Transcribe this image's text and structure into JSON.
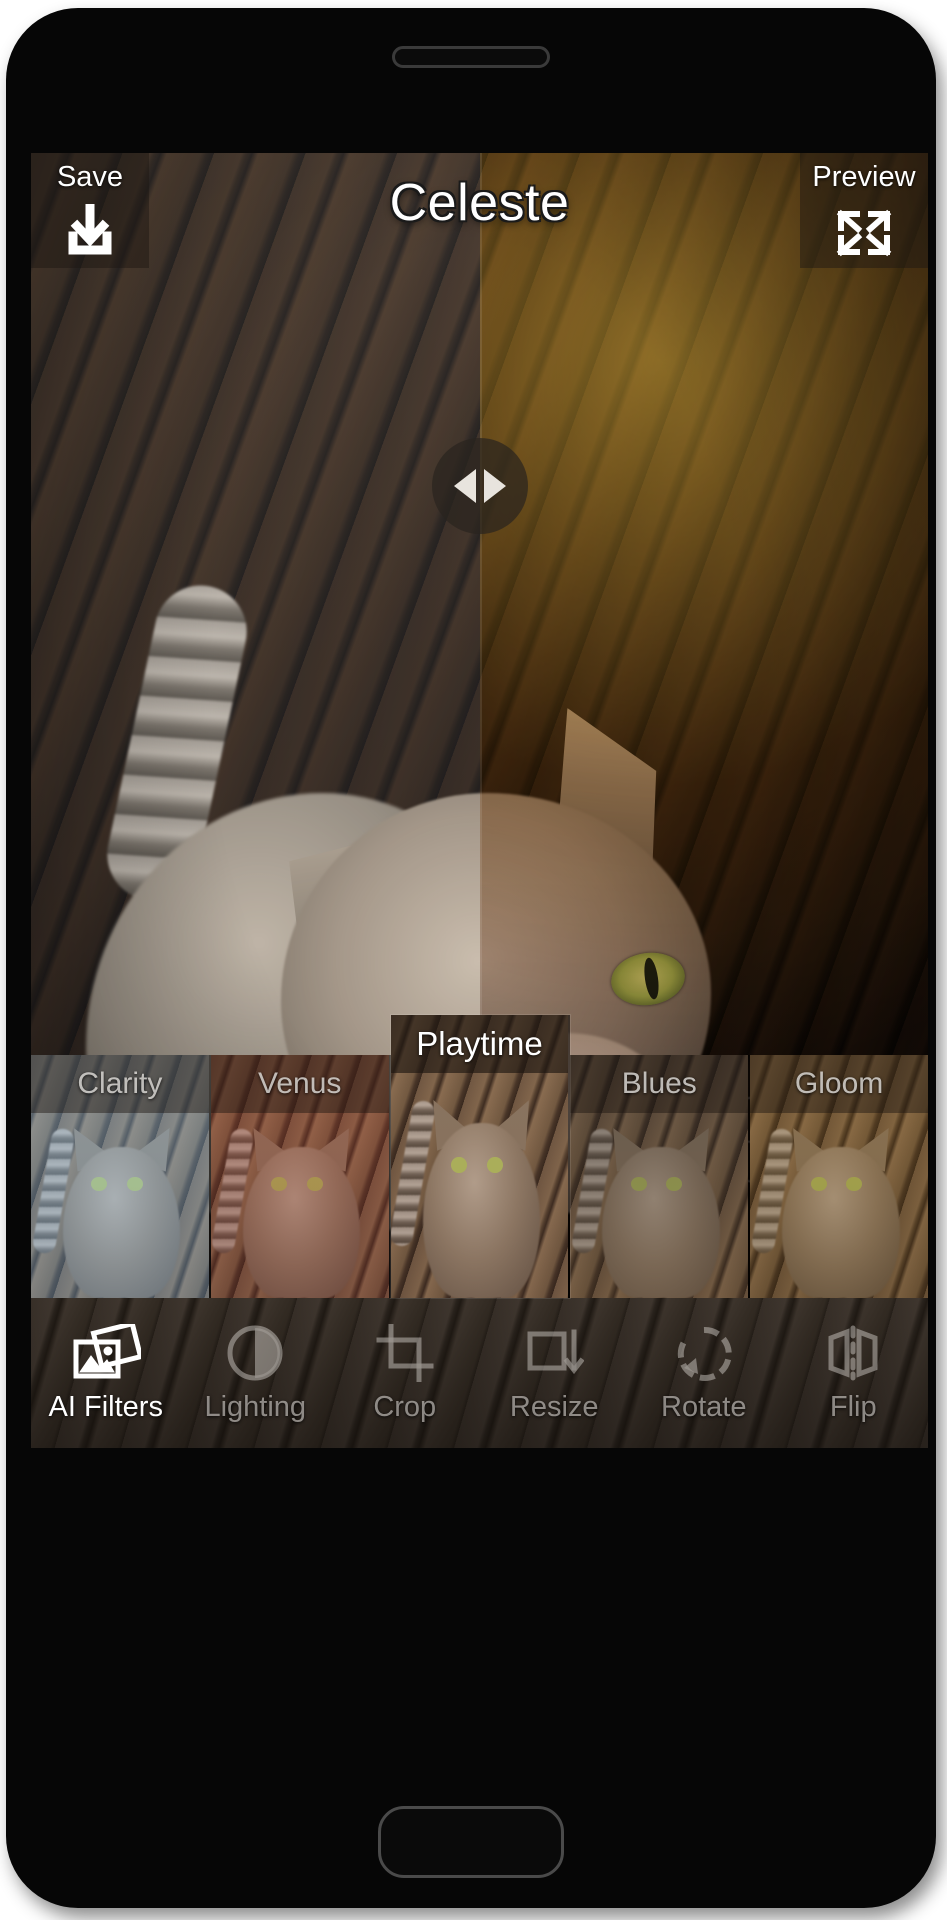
{
  "app": {
    "title": "Celeste",
    "type": "photo-editor"
  },
  "topbar": {
    "save": {
      "label": "Save",
      "icon": "download-icon"
    },
    "preview": {
      "label": "Preview",
      "icon": "expand-arrows-icon"
    }
  },
  "compare_slider": {
    "handle_icon": "left-right-arrows-icon",
    "position_percent": 50
  },
  "filters": {
    "selected": "Playtime",
    "items": [
      {
        "label": "Clarity",
        "selected": false,
        "tint": "linear-gradient(180deg, rgba(150,185,215,0.45), rgba(120,155,190,0.40))"
      },
      {
        "label": "Venus",
        "selected": false,
        "tint": "linear-gradient(180deg, rgba(170,75,55,0.40), rgba(120,55,45,0.42))"
      },
      {
        "label": "Playtime",
        "selected": true,
        "tint": "linear-gradient(180deg, rgba(140,95,70,0.22), rgba(110,70,55,0.26))"
      },
      {
        "label": "Blues",
        "selected": false,
        "tint": "linear-gradient(180deg, rgba(60,50,45,0.46), rgba(90,65,45,0.40))"
      },
      {
        "label": "Gloom",
        "selected": false,
        "tint": "linear-gradient(180deg, rgba(145,100,40,0.34), rgba(95,65,30,0.40))"
      }
    ]
  },
  "toolbar": {
    "active": "AI Filters",
    "items": [
      {
        "label": "AI Filters",
        "icon": "photo-stack-icon",
        "active": true
      },
      {
        "label": "Lighting",
        "icon": "half-circle-icon",
        "active": false
      },
      {
        "label": "Crop",
        "icon": "crop-icon",
        "active": false
      },
      {
        "label": "Resize",
        "icon": "resize-icon",
        "active": false
      },
      {
        "label": "Rotate",
        "icon": "rotate-icon",
        "active": false
      },
      {
        "label": "Flip",
        "icon": "flip-icon",
        "active": false
      }
    ]
  },
  "colors": {
    "accent_white": "#ffffff",
    "dim_label": "rgba(216,212,206,0.62)",
    "panel_overlay": "rgba(30,24,18,0.48)",
    "phone_body": "#060606"
  }
}
